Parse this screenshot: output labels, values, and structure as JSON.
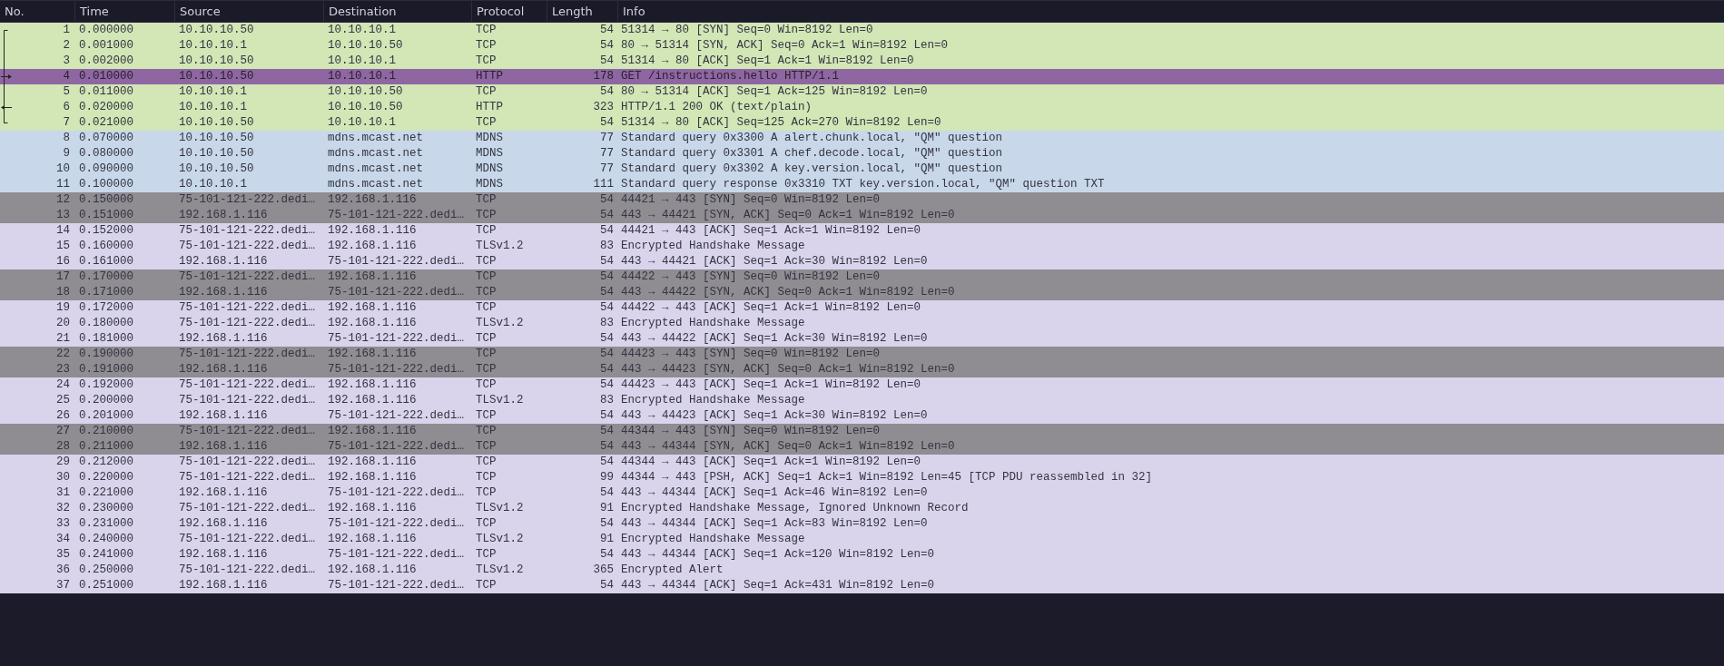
{
  "columns": [
    "No.",
    "Time",
    "Source",
    "Destination",
    "Protocol",
    "Length",
    "Info"
  ],
  "rows": [
    {
      "no": "1",
      "time": "0.000000",
      "source": "10.10.10.50",
      "destination": "10.10.10.1",
      "protocol": "TCP",
      "length": "54",
      "info": "51314 → 80 [SYN] Seq=0 Win=8192 Len=0",
      "color": "#d2e6b6",
      "selected": false,
      "kind": "start"
    },
    {
      "no": "2",
      "time": "0.001000",
      "source": "10.10.10.1",
      "destination": "10.10.10.50",
      "protocol": "TCP",
      "length": "54",
      "info": "80 → 51314 [SYN, ACK] Seq=0 Ack=1 Win=8192 Len=0",
      "color": "#d2e6b6",
      "selected": false,
      "kind": "line"
    },
    {
      "no": "3",
      "time": "0.002000",
      "source": "10.10.10.50",
      "destination": "10.10.10.1",
      "protocol": "TCP",
      "length": "54",
      "info": "51314 → 80 [ACK] Seq=1 Ack=1 Win=8192 Len=0",
      "color": "#d2e6b6",
      "selected": false,
      "kind": "line"
    },
    {
      "no": "4",
      "time": "0.010000",
      "source": "10.10.10.50",
      "destination": "10.10.10.1",
      "protocol": "HTTP",
      "length": "178",
      "info": "GET /instructions.hello HTTP/1.1",
      "selected": true,
      "kind": "request"
    },
    {
      "no": "5",
      "time": "0.011000",
      "source": "10.10.10.1",
      "destination": "10.10.10.50",
      "protocol": "TCP",
      "length": "54",
      "info": "80 → 51314 [ACK] Seq=1 Ack=125 Win=8192 Len=0",
      "color": "#d2e6b6",
      "selected": false,
      "kind": "line"
    },
    {
      "no": "6",
      "time": "0.020000",
      "source": "10.10.10.1",
      "destination": "10.10.10.50",
      "protocol": "HTTP",
      "length": "323",
      "info": "HTTP/1.1 200 OK  (text/plain)",
      "color": "#d2e6b6",
      "selected": false,
      "kind": "response"
    },
    {
      "no": "7",
      "time": "0.021000",
      "source": "10.10.10.50",
      "destination": "10.10.10.1",
      "protocol": "TCP",
      "length": "54",
      "info": "51314 → 80 [ACK] Seq=125 Ack=270 Win=8192 Len=0",
      "color": "#d2e6b6",
      "selected": false,
      "kind": "end"
    },
    {
      "no": "8",
      "time": "0.070000",
      "source": "10.10.10.50",
      "destination": "mdns.mcast.net",
      "protocol": "MDNS",
      "length": "77",
      "info": "Standard query 0x3300 A alert.chunk.local, \"QM\" question",
      "color": "#c8d8ea",
      "selected": false
    },
    {
      "no": "9",
      "time": "0.080000",
      "source": "10.10.10.50",
      "destination": "mdns.mcast.net",
      "protocol": "MDNS",
      "length": "77",
      "info": "Standard query 0x3301 A chef.decode.local, \"QM\" question",
      "color": "#c8d8ea",
      "selected": false
    },
    {
      "no": "10",
      "time": "0.090000",
      "source": "10.10.10.50",
      "destination": "mdns.mcast.net",
      "protocol": "MDNS",
      "length": "77",
      "info": "Standard query 0x3302 A key.version.local, \"QM\" question",
      "color": "#c8d8ea",
      "selected": false
    },
    {
      "no": "11",
      "time": "0.100000",
      "source": "10.10.10.1",
      "destination": "mdns.mcast.net",
      "protocol": "MDNS",
      "length": "111",
      "info": "Standard query response 0x3310 TXT key.version.local, \"QM\" question TXT",
      "color": "#c8d8ea",
      "selected": false
    },
    {
      "no": "12",
      "time": "0.150000",
      "source": "75-101-121-222.dedi…",
      "destination": "192.168.1.116",
      "protocol": "TCP",
      "length": "54",
      "info": "44421 → 443 [SYN] Seq=0 Win=8192 Len=0",
      "color": "#8f8c92",
      "selected": false
    },
    {
      "no": "13",
      "time": "0.151000",
      "source": "192.168.1.116",
      "destination": "75-101-121-222.dedi…",
      "protocol": "TCP",
      "length": "54",
      "info": "443 → 44421 [SYN, ACK] Seq=0 Ack=1 Win=8192 Len=0",
      "color": "#8f8c92",
      "selected": false
    },
    {
      "no": "14",
      "time": "0.152000",
      "source": "75-101-121-222.dedi…",
      "destination": "192.168.1.116",
      "protocol": "TCP",
      "length": "54",
      "info": "44421 → 443 [ACK] Seq=1 Ack=1 Win=8192 Len=0",
      "color": "#d9d4ec",
      "selected": false
    },
    {
      "no": "15",
      "time": "0.160000",
      "source": "75-101-121-222.dedi…",
      "destination": "192.168.1.116",
      "protocol": "TLSv1.2",
      "length": "83",
      "info": "Encrypted Handshake Message",
      "color": "#d9d4ec",
      "selected": false
    },
    {
      "no": "16",
      "time": "0.161000",
      "source": "192.168.1.116",
      "destination": "75-101-121-222.dedi…",
      "protocol": "TCP",
      "length": "54",
      "info": "443 → 44421 [ACK] Seq=1 Ack=30 Win=8192 Len=0",
      "color": "#d9d4ec",
      "selected": false
    },
    {
      "no": "17",
      "time": "0.170000",
      "source": "75-101-121-222.dedi…",
      "destination": "192.168.1.116",
      "protocol": "TCP",
      "length": "54",
      "info": "44422 → 443 [SYN] Seq=0 Win=8192 Len=0",
      "color": "#8f8c92",
      "selected": false
    },
    {
      "no": "18",
      "time": "0.171000",
      "source": "192.168.1.116",
      "destination": "75-101-121-222.dedi…",
      "protocol": "TCP",
      "length": "54",
      "info": "443 → 44422 [SYN, ACK] Seq=0 Ack=1 Win=8192 Len=0",
      "color": "#8f8c92",
      "selected": false
    },
    {
      "no": "19",
      "time": "0.172000",
      "source": "75-101-121-222.dedi…",
      "destination": "192.168.1.116",
      "protocol": "TCP",
      "length": "54",
      "info": "44422 → 443 [ACK] Seq=1 Ack=1 Win=8192 Len=0",
      "color": "#d9d4ec",
      "selected": false
    },
    {
      "no": "20",
      "time": "0.180000",
      "source": "75-101-121-222.dedi…",
      "destination": "192.168.1.116",
      "protocol": "TLSv1.2",
      "length": "83",
      "info": "Encrypted Handshake Message",
      "color": "#d9d4ec",
      "selected": false
    },
    {
      "no": "21",
      "time": "0.181000",
      "source": "192.168.1.116",
      "destination": "75-101-121-222.dedi…",
      "protocol": "TCP",
      "length": "54",
      "info": "443 → 44422 [ACK] Seq=1 Ack=30 Win=8192 Len=0",
      "color": "#d9d4ec",
      "selected": false
    },
    {
      "no": "22",
      "time": "0.190000",
      "source": "75-101-121-222.dedi…",
      "destination": "192.168.1.116",
      "protocol": "TCP",
      "length": "54",
      "info": "44423 → 443 [SYN] Seq=0 Win=8192 Len=0",
      "color": "#8f8c92",
      "selected": false
    },
    {
      "no": "23",
      "time": "0.191000",
      "source": "192.168.1.116",
      "destination": "75-101-121-222.dedi…",
      "protocol": "TCP",
      "length": "54",
      "info": "443 → 44423 [SYN, ACK] Seq=0 Ack=1 Win=8192 Len=0",
      "color": "#8f8c92",
      "selected": false
    },
    {
      "no": "24",
      "time": "0.192000",
      "source": "75-101-121-222.dedi…",
      "destination": "192.168.1.116",
      "protocol": "TCP",
      "length": "54",
      "info": "44423 → 443 [ACK] Seq=1 Ack=1 Win=8192 Len=0",
      "color": "#d9d4ec",
      "selected": false
    },
    {
      "no": "25",
      "time": "0.200000",
      "source": "75-101-121-222.dedi…",
      "destination": "192.168.1.116",
      "protocol": "TLSv1.2",
      "length": "83",
      "info": "Encrypted Handshake Message",
      "color": "#d9d4ec",
      "selected": false
    },
    {
      "no": "26",
      "time": "0.201000",
      "source": "192.168.1.116",
      "destination": "75-101-121-222.dedi…",
      "protocol": "TCP",
      "length": "54",
      "info": "443 → 44423 [ACK] Seq=1 Ack=30 Win=8192 Len=0",
      "color": "#d9d4ec",
      "selected": false
    },
    {
      "no": "27",
      "time": "0.210000",
      "source": "75-101-121-222.dedi…",
      "destination": "192.168.1.116",
      "protocol": "TCP",
      "length": "54",
      "info": "44344 → 443 [SYN] Seq=0 Win=8192 Len=0",
      "color": "#8f8c92",
      "selected": false
    },
    {
      "no": "28",
      "time": "0.211000",
      "source": "192.168.1.116",
      "destination": "75-101-121-222.dedi…",
      "protocol": "TCP",
      "length": "54",
      "info": "443 → 44344 [SYN, ACK] Seq=0 Ack=1 Win=8192 Len=0",
      "color": "#8f8c92",
      "selected": false
    },
    {
      "no": "29",
      "time": "0.212000",
      "source": "75-101-121-222.dedi…",
      "destination": "192.168.1.116",
      "protocol": "TCP",
      "length": "54",
      "info": "44344 → 443 [ACK] Seq=1 Ack=1 Win=8192 Len=0",
      "color": "#d9d4ec",
      "selected": false
    },
    {
      "no": "30",
      "time": "0.220000",
      "source": "75-101-121-222.dedi…",
      "destination": "192.168.1.116",
      "protocol": "TCP",
      "length": "99",
      "info": "44344 → 443 [PSH, ACK] Seq=1 Ack=1 Win=8192 Len=45 [TCP PDU reassembled in 32]",
      "color": "#d9d4ec",
      "selected": false
    },
    {
      "no": "31",
      "time": "0.221000",
      "source": "192.168.1.116",
      "destination": "75-101-121-222.dedi…",
      "protocol": "TCP",
      "length": "54",
      "info": "443 → 44344 [ACK] Seq=1 Ack=46 Win=8192 Len=0",
      "color": "#d9d4ec",
      "selected": false
    },
    {
      "no": "32",
      "time": "0.230000",
      "source": "75-101-121-222.dedi…",
      "destination": "192.168.1.116",
      "protocol": "TLSv1.2",
      "length": "91",
      "info": "Encrypted Handshake Message, Ignored Unknown Record",
      "color": "#d9d4ec",
      "selected": false
    },
    {
      "no": "33",
      "time": "0.231000",
      "source": "192.168.1.116",
      "destination": "75-101-121-222.dedi…",
      "protocol": "TCP",
      "length": "54",
      "info": "443 → 44344 [ACK] Seq=1 Ack=83 Win=8192 Len=0",
      "color": "#d9d4ec",
      "selected": false
    },
    {
      "no": "34",
      "time": "0.240000",
      "source": "75-101-121-222.dedi…",
      "destination": "192.168.1.116",
      "protocol": "TLSv1.2",
      "length": "91",
      "info": "Encrypted Handshake Message",
      "color": "#d9d4ec",
      "selected": false
    },
    {
      "no": "35",
      "time": "0.241000",
      "source": "192.168.1.116",
      "destination": "75-101-121-222.dedi…",
      "protocol": "TCP",
      "length": "54",
      "info": "443 → 44344 [ACK] Seq=1 Ack=120 Win=8192 Len=0",
      "color": "#d9d4ec",
      "selected": false
    },
    {
      "no": "36",
      "time": "0.250000",
      "source": "75-101-121-222.dedi…",
      "destination": "192.168.1.116",
      "protocol": "TLSv1.2",
      "length": "365",
      "info": "Encrypted Alert",
      "color": "#d9d4ec",
      "selected": false
    },
    {
      "no": "37",
      "time": "0.251000",
      "source": "192.168.1.116",
      "destination": "75-101-121-222.dedi…",
      "protocol": "TCP",
      "length": "54",
      "info": "443 → 44344 [ACK] Seq=1 Ack=431 Win=8192 Len=0",
      "color": "#d9d4ec",
      "selected": false
    }
  ]
}
